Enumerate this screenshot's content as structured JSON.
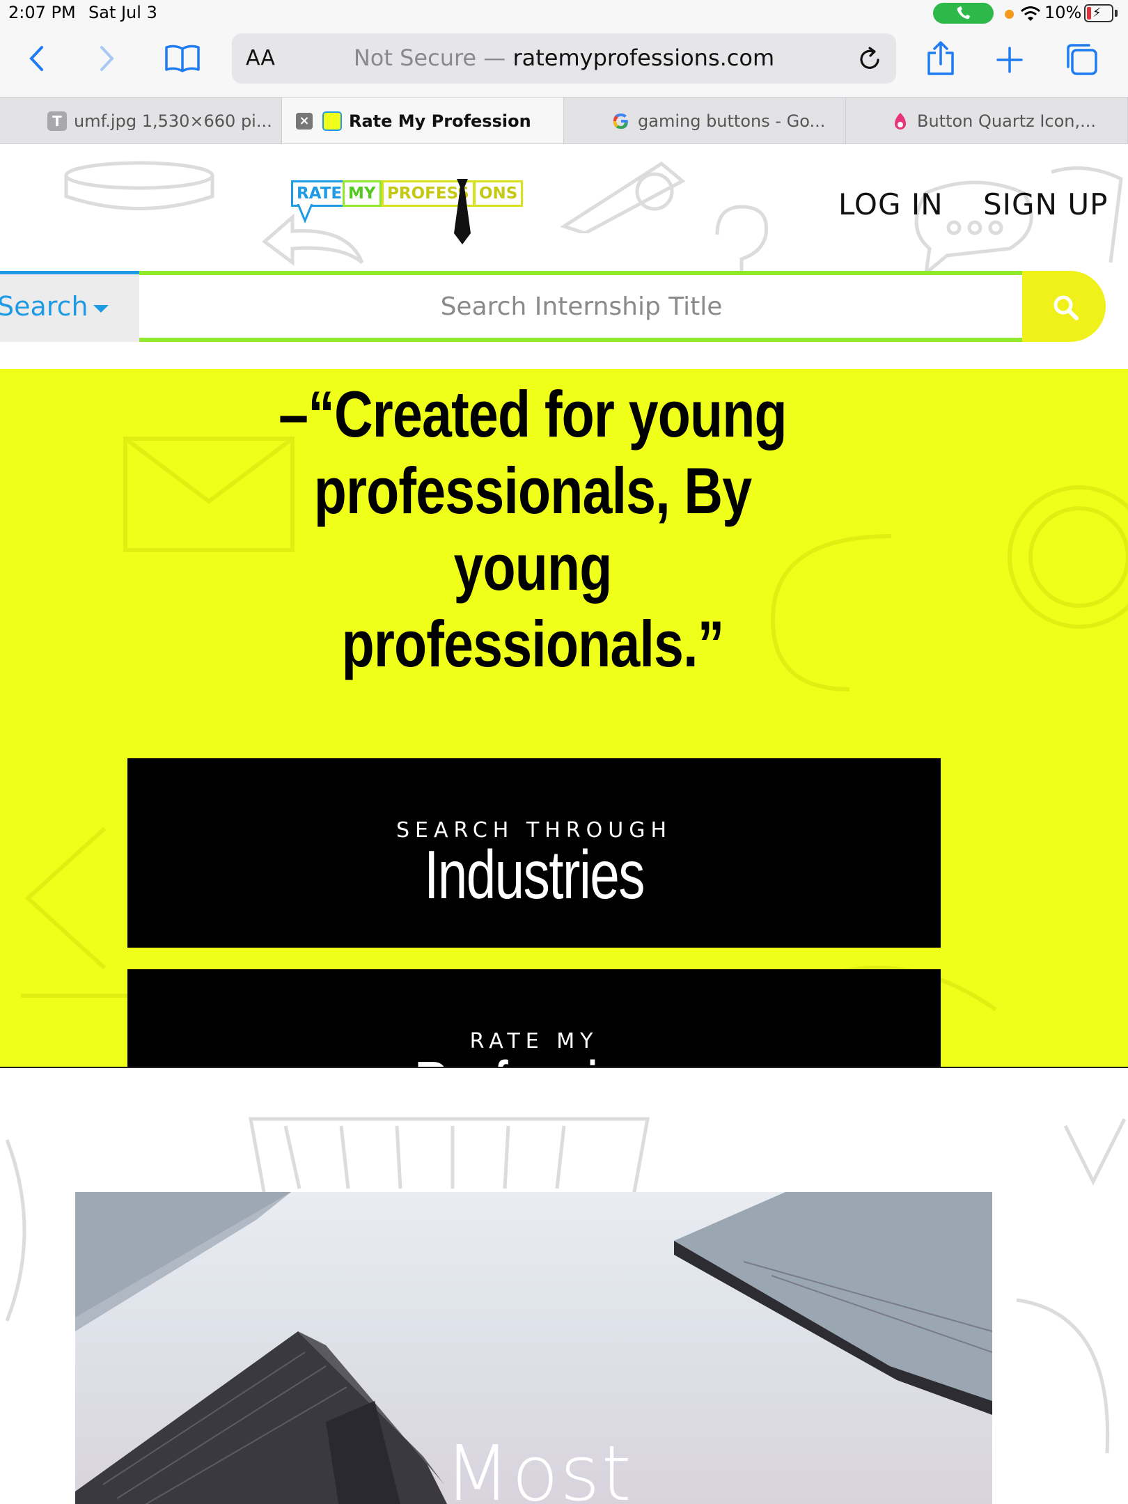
{
  "status_bar": {
    "time": "2:07 PM",
    "date": "Sat Jul 3",
    "battery": "10%"
  },
  "browser": {
    "aa_label": "AA",
    "url_prefix": "Not Secure —",
    "url_domain": "ratemyprofessions.com",
    "tabs": [
      {
        "label": "umf.jpg 1,530×660 pi...",
        "favicon": "T"
      },
      {
        "label": "Rate My Profession"
      },
      {
        "label": "gaming buttons - Go..."
      },
      {
        "label": "Button Quartz Icon,..."
      }
    ]
  },
  "header": {
    "logo": {
      "rate": "RATE",
      "my": "MY",
      "profess": "PROFESS",
      "ons": "ONS"
    },
    "login": "LOG IN",
    "signup": "SIGN UP"
  },
  "search": {
    "dropdown_label": "Search",
    "placeholder": "Search Internship Title"
  },
  "hero": {
    "quote": "–“Created for young professionals, By young professionals.”",
    "cta1_small": "SEARCH THROUGH",
    "cta1_big": "Industries",
    "cta2_small": "RATE MY",
    "cta2_big": "Profession"
  },
  "section": {
    "caption": "Most"
  },
  "colors": {
    "accent_yellow": "#f0ff1a",
    "accent_blue": "#1f9be6",
    "accent_green": "#8fe82b",
    "ios_blue": "#1f7bf2"
  }
}
